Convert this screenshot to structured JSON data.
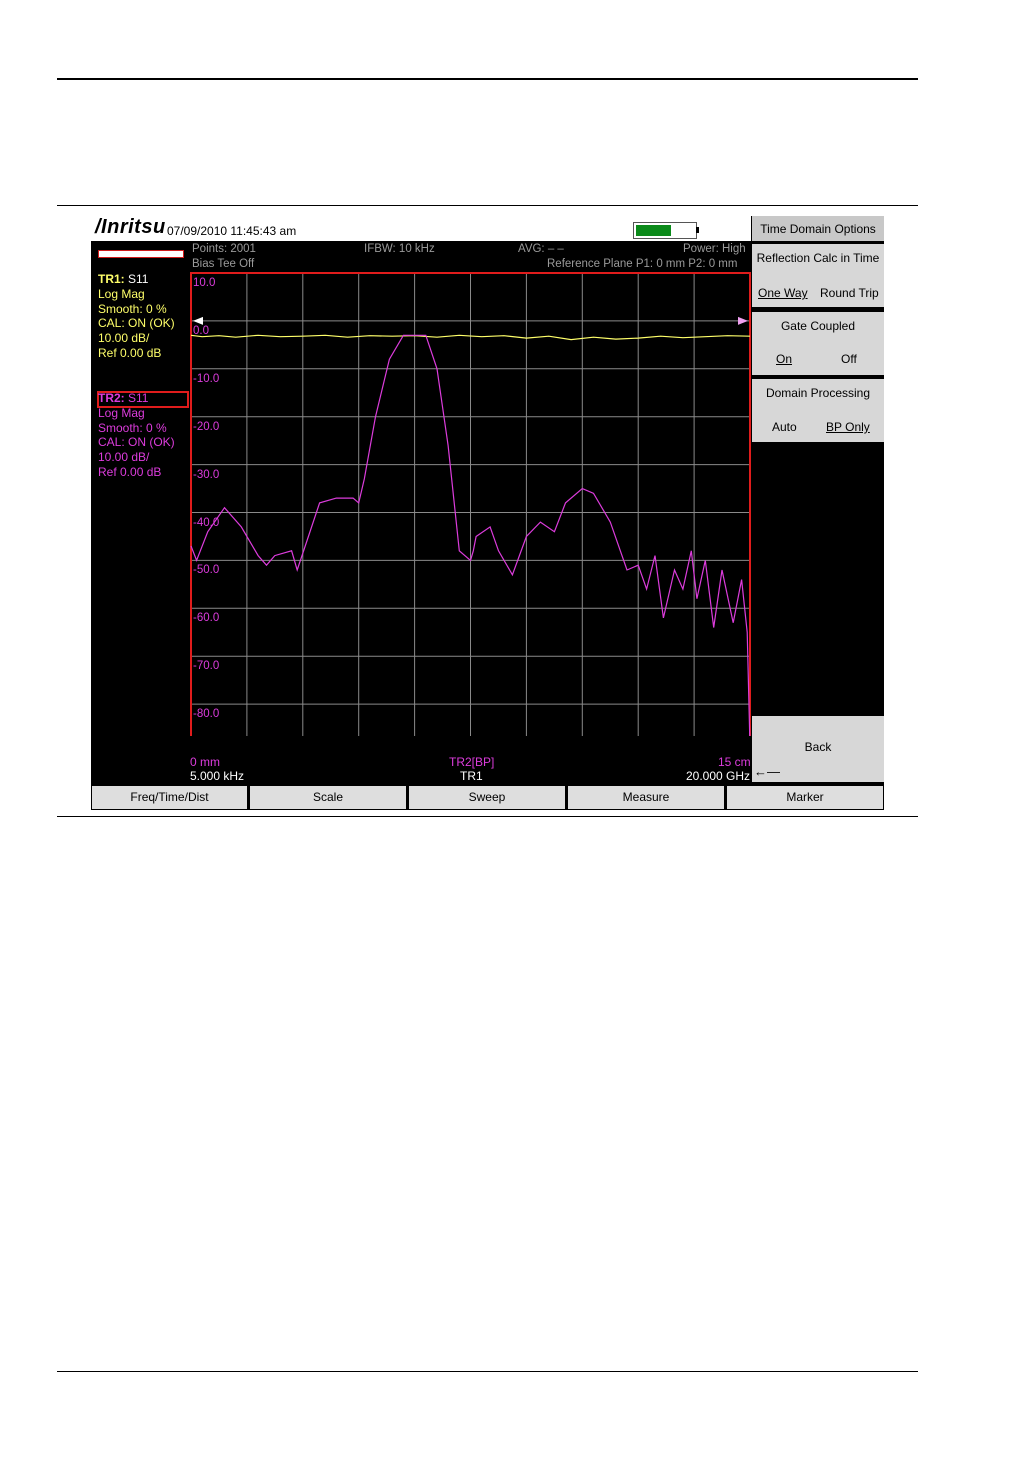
{
  "titlebar": {
    "brand": "/Inritsu",
    "datetime": "07/09/2010 11:45:43 am",
    "battery_level": 0.6
  },
  "status": {
    "points": "Points: 2001",
    "ifbw": "IFBW: 10 kHz",
    "avg": "AVG: – –",
    "power": "Power: High",
    "bias_tee": "Bias Tee Off",
    "ref_plane": "Reference Plane P1: 0 mm P2: 0 mm"
  },
  "trace1": {
    "name": "TR1:",
    "param": "S11",
    "format": "Log Mag",
    "smooth": "Smooth: 0 %",
    "cal": "CAL: ON (OK)",
    "scale": "10.00 dB/",
    "ref": "Ref 0.00 dB"
  },
  "trace2": {
    "name": "TR2:",
    "param": "S11",
    "format": "Log Mag",
    "smooth": "Smooth: 0 %",
    "cal": "CAL: ON (OK)",
    "scale": "10.00 dB/",
    "ref": "Ref 0.00 dB"
  },
  "axis": {
    "y_labels": [
      "10.0",
      "0.0",
      "-10.0",
      "-20.0",
      "-30.0",
      "-40.0",
      "-50.0",
      "-60.0",
      "-70.0",
      "-80.0"
    ],
    "x_start_dist": "0 mm",
    "x_center_label": "TR2[BP]",
    "x_end_dist": "15 cm",
    "x_start_freq": "5.000 kHz",
    "x_center_label2": "TR1",
    "x_end_freq": "20.000 GHz"
  },
  "softkeys": {
    "menu_title": "Time Domain Options",
    "reflection": {
      "title": "Reflection Calc in Time",
      "opt1": "One Way",
      "opt2": "Round Trip"
    },
    "gate": {
      "title": "Gate Coupled",
      "opt1": "On",
      "opt2": "Off"
    },
    "domain": {
      "title": "Domain Processing",
      "opt1": "Auto",
      "opt2": "BP Only"
    },
    "back": "Back"
  },
  "bottom_menu": [
    "Freq/Time/Dist",
    "Scale",
    "Sweep",
    "Measure",
    "Marker"
  ],
  "colors": {
    "trace1": "#ffff6a",
    "trace2": "#dc3cdc",
    "grid_border": "#e01c1c",
    "grid": "#8a8a8a",
    "battery": "#0b8a1a"
  },
  "chart_data": {
    "type": "line",
    "ylim": [
      -90,
      10
    ],
    "y_ticks": [
      10,
      0,
      -10,
      -20,
      -30,
      -40,
      -50,
      -60,
      -70,
      -80
    ],
    "x_divisions": 10,
    "series": [
      {
        "name": "TR1",
        "x": [
          0,
          0.02,
          0.05,
          0.08,
          0.12,
          0.16,
          0.2,
          0.24,
          0.28,
          0.32,
          0.36,
          0.4,
          0.44,
          0.48,
          0.52,
          0.56,
          0.6,
          0.64,
          0.68,
          0.72,
          0.76,
          0.8,
          0.84,
          0.88,
          0.92,
          0.96,
          1.0
        ],
        "y": [
          -3.0,
          -3.3,
          -3.1,
          -3.4,
          -3.0,
          -3.3,
          -3.2,
          -3.0,
          -3.4,
          -3.1,
          -3.2,
          -3.1,
          -3.4,
          -3.0,
          -3.3,
          -3.1,
          -3.6,
          -3.2,
          -3.9,
          -3.4,
          -3.8,
          -3.6,
          -3.2,
          -3.5,
          -3.3,
          -3.1,
          -3.2
        ]
      },
      {
        "name": "TR2",
        "x": [
          0,
          0.01,
          0.03,
          0.06,
          0.09,
          0.12,
          0.135,
          0.15,
          0.18,
          0.19,
          0.21,
          0.23,
          0.26,
          0.29,
          0.3,
          0.31,
          0.33,
          0.355,
          0.38,
          0.4,
          0.42,
          0.44,
          0.46,
          0.48,
          0.5,
          0.505,
          0.51,
          0.535,
          0.55,
          0.575,
          0.6,
          0.625,
          0.65,
          0.67,
          0.7,
          0.72,
          0.75,
          0.78,
          0.8,
          0.815,
          0.83,
          0.845,
          0.865,
          0.88,
          0.895,
          0.905,
          0.92,
          0.935,
          0.95,
          0.97,
          0.985,
          0.995,
          1.0
        ],
        "y": [
          -47,
          -50,
          -44,
          -39,
          -43,
          -49,
          -51,
          -49,
          -48,
          -52,
          -45,
          -38,
          -37,
          -37,
          -38,
          -33,
          -20,
          -8,
          -3,
          -3,
          -3,
          -10,
          -26,
          -48,
          -50,
          -48,
          -45,
          -43,
          -48,
          -53,
          -45,
          -42,
          -44,
          -38,
          -35,
          -36,
          -42,
          -52,
          -51,
          -56,
          -49,
          -62,
          -52,
          -56,
          -48,
          -58,
          -50,
          -64,
          -52,
          -63,
          -54,
          -65,
          -89
        ]
      }
    ]
  }
}
